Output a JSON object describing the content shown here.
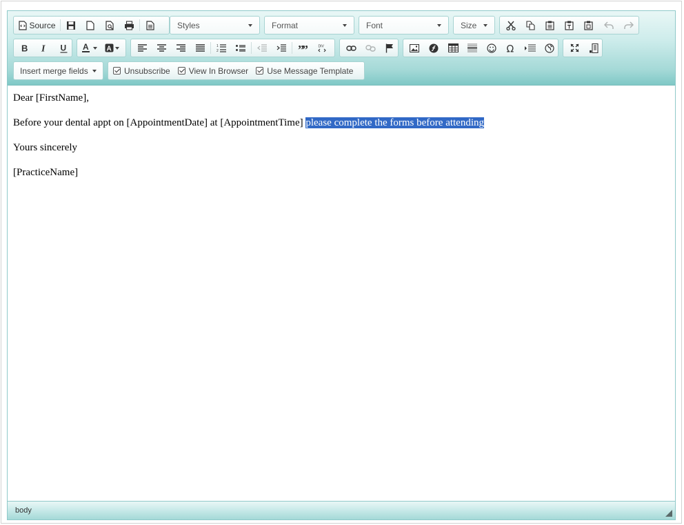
{
  "toolbar": {
    "source_label": "Source",
    "combos": {
      "styles": "Styles",
      "format": "Format",
      "font": "Font",
      "size": "Size"
    },
    "insert_merge_fields": "Insert merge fields",
    "checkboxes": {
      "unsubscribe": "Unsubscribe",
      "view_in_browser": "View In Browser",
      "use_message_template": "Use Message Template"
    }
  },
  "content": {
    "line1": "Dear [FirstName],",
    "line2_plain": "Before your dental appt on [AppointmentDate] at [AppointmentTime] ",
    "line2_selected": "please complete the forms before attending",
    "line3": "Yours sincerely",
    "line4": "[PracticeName]"
  },
  "status": {
    "path": "body"
  },
  "colors": {
    "toolbar_accent": "#8fc9c9",
    "selection": "#3169c6"
  }
}
